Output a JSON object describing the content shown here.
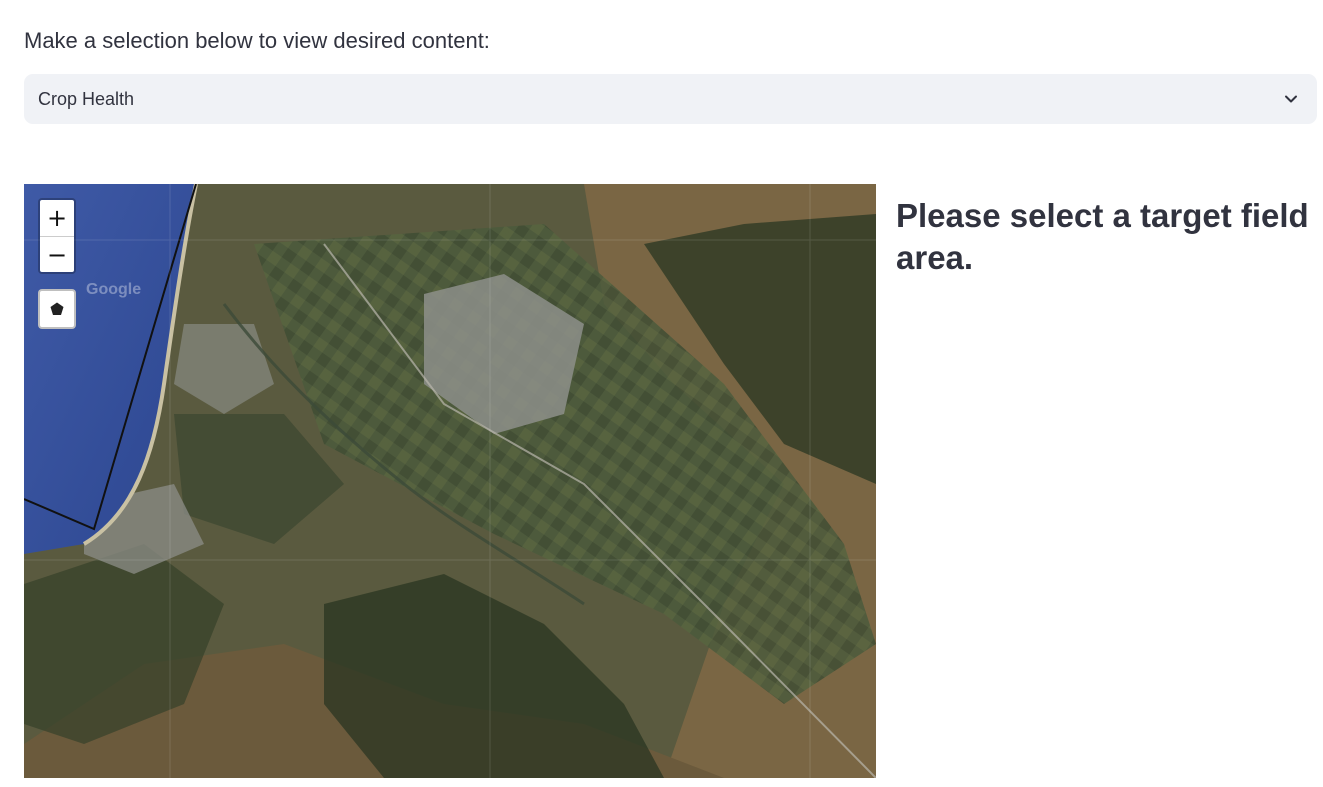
{
  "instruction": "Make a selection below to view desired content:",
  "select": {
    "value": "Crop Health",
    "chevron_icon": "chevron-down-icon"
  },
  "map": {
    "zoom_in_label": "+",
    "zoom_out_label": "−",
    "draw_icon": "polygon-icon",
    "watermark": "Google"
  },
  "prompt": "Please select a target field area."
}
